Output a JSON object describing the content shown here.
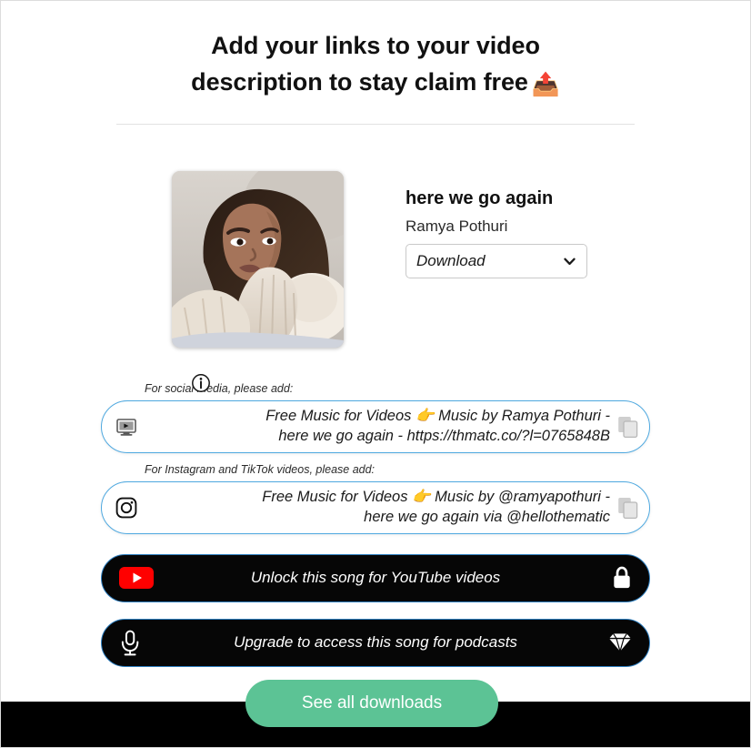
{
  "header": {
    "title_line1": "Add your links to your video",
    "title_line2": "description to stay claim free",
    "title_emoji": "📤",
    "emoji_name": "outbox-tray-emoji"
  },
  "song": {
    "title": "here we go again",
    "artist": "Ramya Pothuri",
    "artwork_alt": "here we go again album artwork",
    "download_select": {
      "value": "Download",
      "options": [
        "Download"
      ],
      "chevron": "chevron-down-icon"
    }
  },
  "social": {
    "label": "For social media, please add:",
    "info_icon": "info-icon",
    "lead_icon": "screen-play-icon",
    "copy_icon": "copy-icon",
    "text_line1": "Free Music for Videos 👉 Music by Ramya Pothuri -",
    "text_line2": "here we go again - https://thmatc.co/?l=0765848B",
    "text_full": "Free Music for Videos 👉 Music by Ramya Pothuri - here we go again - https://thmatc.co/?l=0765848B"
  },
  "instagram": {
    "label": "For Instagram and TikTok videos, please add:",
    "lead_icon": "instagram-icon",
    "copy_icon": "copy-icon",
    "text_line1": "Free Music for Videos 👉 Music by @ramyapothuri -",
    "text_line2": "here we go again via @hellothematic",
    "text_full": "Free Music for Videos 👉 Music by @ramyapothuri - here we go again via @hellothematic"
  },
  "youtube_cta": {
    "label": "Unlock this song for YouTube videos",
    "left_icon": "youtube-icon",
    "right_icon": "lock-icon"
  },
  "podcast_cta": {
    "label": "Upgrade to access this song for podcasts",
    "left_icon": "microphone-icon",
    "right_icon": "diamond-icon"
  },
  "footer": {
    "see_all_label": "See all downloads"
  },
  "colors": {
    "accent_blue": "#4fa9e0",
    "cta_green": "#5cc395",
    "dark_pill": "#060606",
    "youtube_red": "#ff0000",
    "footer_black": "#000000",
    "divider_gray": "#e2e2e2"
  }
}
